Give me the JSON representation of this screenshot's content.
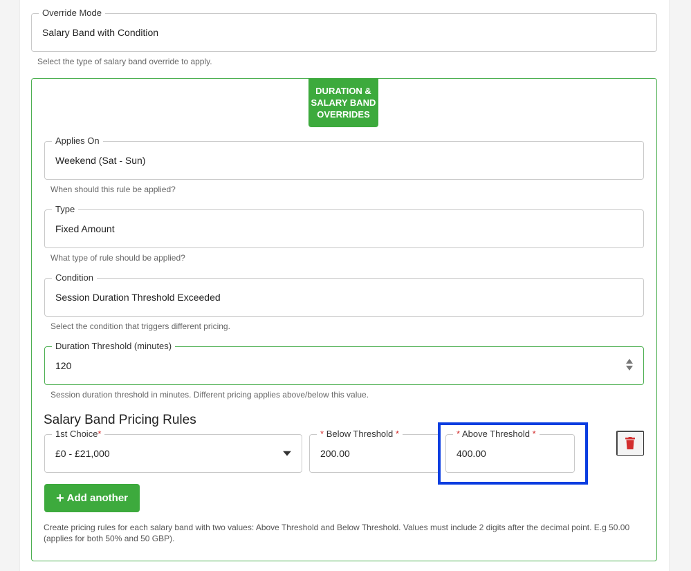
{
  "override_mode": {
    "label": "Override Mode",
    "value": "Salary Band with Condition",
    "helper": "Select the type of salary band override to apply."
  },
  "section": {
    "badge": "DURATION & SALARY BAND OVERRIDES",
    "applies_on": {
      "label": "Applies On",
      "value": "Weekend (Sat - Sun)",
      "helper": "When should this rule be applied?"
    },
    "type": {
      "label": "Type",
      "value": "Fixed Amount",
      "helper": "What type of rule should be applied?"
    },
    "condition": {
      "label": "Condition",
      "value": "Session Duration Threshold Exceeded",
      "helper": "Select the condition that triggers different pricing."
    },
    "duration_threshold": {
      "label": "Duration Threshold (minutes)",
      "value": "120",
      "helper": "Session duration threshold in minutes. Different pricing applies above/below this value."
    },
    "pricing_rules": {
      "title": "Salary Band Pricing Rules",
      "rows": [
        {
          "choice_label": "1st Choice",
          "choice_value": "£0 - £21,000",
          "below_label": "Below Threshold",
          "below_value": "200.00",
          "above_label": "Above Threshold",
          "above_value": "400.00"
        }
      ],
      "required_mark": "*",
      "add_button": "Add another",
      "add_icon": "+",
      "note": "Create pricing rules for each salary band with two values: Above Threshold and Below Threshold. Values must include 2 digits after the decimal point. E.g 50.00 (applies for both 50% and 50 GBP)."
    }
  },
  "colors": {
    "accent_green": "#3daa3d",
    "highlight_blue": "#0a3de0",
    "required_red": "#d32f2f",
    "trash_red": "#d32f2f"
  },
  "icons": {
    "trash": "trash-icon",
    "plus": "plus-icon",
    "dropdown": "chevron-down-icon",
    "stepper": "spinner-icon"
  }
}
